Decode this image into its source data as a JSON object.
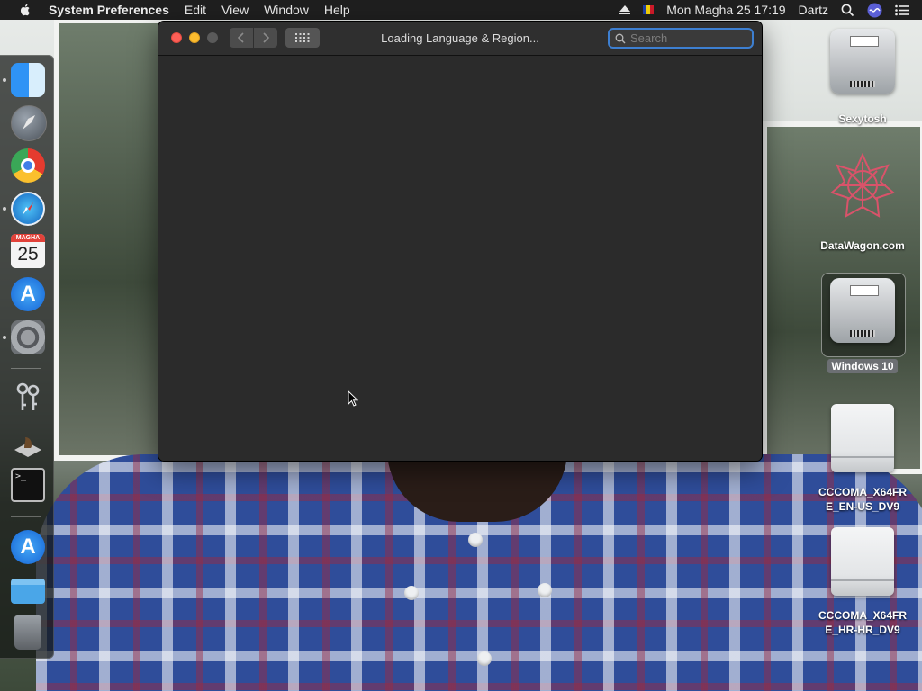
{
  "menubar": {
    "app_name": "System Preferences",
    "menus": [
      "Edit",
      "View",
      "Window",
      "Help"
    ],
    "clock": "Mon Magha 25  17:19",
    "user": "Dartz"
  },
  "window": {
    "title": "Loading Language & Region...",
    "search_placeholder": "Search"
  },
  "dock": {
    "calendar_month": "MAGHA",
    "calendar_day": "25",
    "terminal_prompt": ">_"
  },
  "desktop": {
    "icons": [
      {
        "label": "Sexytosh"
      },
      {
        "label": "DataWagon.com"
      },
      {
        "label": "Windows 10"
      },
      {
        "label": "CCCOMA_X64FRE_EN-US_DV9"
      },
      {
        "label": "CCCOMA_X64FRE_HR-HR_DV9"
      }
    ]
  },
  "colors": {
    "menubar_bg": "#1f1f1f",
    "window_bg": "#2b2b2b",
    "close": "#fc5f57",
    "minimize": "#fdbc2e",
    "search_focus": "#3d7fd1"
  }
}
